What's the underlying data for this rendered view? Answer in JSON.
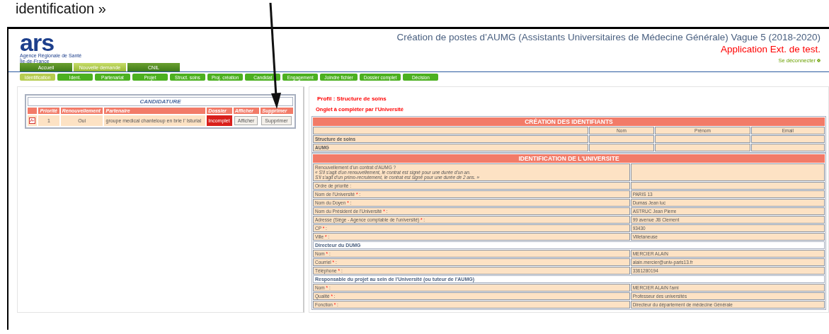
{
  "caption": "identification »",
  "header": {
    "logo_word": "ars",
    "logo_line1": "Agence Régionale de Santé",
    "logo_line2": "Île-de-France",
    "title": "Création de postes d’AUMG (Assistants Universitaires de Médecine Générale) Vague 5 (2018-2020)",
    "subtitle": "Application Ext. de test.",
    "logout": "Se déconnecter"
  },
  "main_tabs": [
    {
      "label": "Accueil",
      "selected": false
    },
    {
      "label": "Nouvelle demande",
      "selected": true
    },
    {
      "label": "CNIL",
      "selected": false
    }
  ],
  "sub_tabs": [
    {
      "label": "Identification",
      "selected": true
    },
    {
      "label": "Ident.",
      "selected": false
    },
    {
      "label": "Partenariat",
      "selected": false
    },
    {
      "label": "Projet",
      "selected": false
    },
    {
      "label": "Struct. soins",
      "selected": false
    },
    {
      "label": "Proj. création",
      "selected": false
    },
    {
      "label": "Candidat",
      "selected": false
    },
    {
      "label": "Engagement",
      "selected": false
    },
    {
      "label": "Joindre fichier",
      "selected": false
    },
    {
      "label": "Dossier complet",
      "selected": false
    },
    {
      "label": "Décision",
      "selected": false
    }
  ],
  "candidature": {
    "title": "CANDIDATURE",
    "columns": [
      "Priorité",
      "Renouvellement",
      "Partenaire",
      "Dossier",
      "Afficher",
      "Supprimer"
    ],
    "rows": [
      {
        "priority": "1",
        "renewal": "Oui",
        "partner": "groupe medical chanteloup en brie l' Isturial",
        "status": "Incomplet",
        "view": "Afficher",
        "delete": "Supprimer"
      }
    ]
  },
  "profile": {
    "title": "Profil : Structure de soins",
    "note": "Onglet à compléter par l'Université"
  },
  "identifiants": {
    "title": "CRÉATION DES IDENTIFIANTS",
    "columns": [
      "Nom",
      "Prénom",
      "Email"
    ],
    "rows": [
      "Structure de soins",
      "AUMG"
    ]
  },
  "universite": {
    "title": "IDENTIFICATION DE L'UNIVERSITE",
    "rows": [
      {
        "kind": "field",
        "label": "Renouvellement d'un contrat d'AUMG ?",
        "notes": [
          "« S'il s'agit d'un renouvellement, le contrat est signé pour une durée d'un an.",
          "S'il s'agit d'un primo-recrutement, le contrat est signé pour une durée de 2 ans. »"
        ]
      },
      {
        "kind": "field",
        "label": "Ordre de priorité",
        "colon": ":"
      },
      {
        "kind": "field",
        "label": "Nom de l'Université",
        "star": "*",
        "colon": ":",
        "value": "PARIS 13"
      },
      {
        "kind": "field",
        "label": "Nom du Doyen",
        "star": "*",
        "colon": ":",
        "value": "Dumas Jean luc"
      },
      {
        "kind": "field",
        "label": "Nom du Président de l'Université",
        "star": "*",
        "colon": ":",
        "value": "ASTRUC Jean Pierre"
      },
      {
        "kind": "field",
        "label": "Adresse (Siège - Agence comptable de l'université)",
        "star": "*",
        "colon": ":",
        "value": "99 avenue JB Clement"
      },
      {
        "kind": "field",
        "label": "CP",
        "star": "*",
        "colon": ":",
        "value": "93430"
      },
      {
        "kind": "field",
        "label": "Ville",
        "star": "*",
        "colon": ":",
        "value": "Villetaneuse"
      },
      {
        "kind": "section",
        "label": "Directeur du DUMG"
      },
      {
        "kind": "field",
        "label": "Nom",
        "star": "*",
        "colon": ":",
        "value": "MERCIER ALAIN"
      },
      {
        "kind": "field",
        "label": "Courriel",
        "star": "*",
        "colon": ":",
        "value": "alain.mercier@univ-paris13.fr"
      },
      {
        "kind": "field",
        "label": "Téléphone",
        "star": "*",
        "colon": ":",
        "value": "3361280194"
      },
      {
        "kind": "section",
        "label": "Responsable du projet au sein de l'Université (ou tuteur de l'AUMG)"
      },
      {
        "kind": "field",
        "label": "Nom",
        "star": "*",
        "colon": ":",
        "value": "MERCIER ALAIN l'ami"
      },
      {
        "kind": "field",
        "label": "Qualité",
        "star": "*",
        "colon": ":",
        "value": "Professeur des universités"
      },
      {
        "kind": "field",
        "label": "Fonction",
        "star": "*",
        "colon": ":",
        "value": "Directeur du département de médecine Générale"
      }
    ]
  }
}
